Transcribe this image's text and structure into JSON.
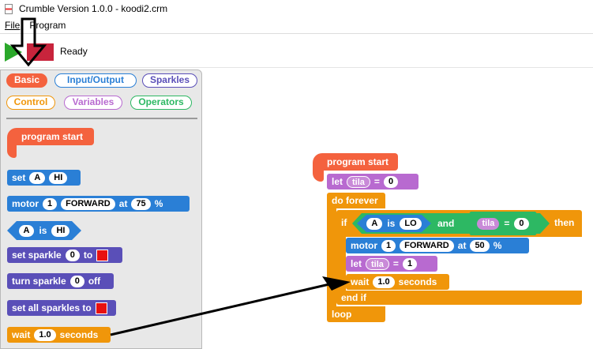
{
  "window": {
    "title": "Crumble Version 1.0.0 - koodi2.crm"
  },
  "menu": {
    "file": "File",
    "program": "Program"
  },
  "toolbar": {
    "status": "Ready"
  },
  "palette": {
    "categories": [
      "Basic",
      "Input/Output",
      "Sparkles",
      "Control",
      "Variables",
      "Operators"
    ],
    "blocks": {
      "program_start": "program start",
      "set_kw": "set",
      "set_pin": "A",
      "set_val": "HI",
      "motor_kw": "motor",
      "motor_num": "1",
      "motor_dir": "FORWARD",
      "motor_at": "at",
      "motor_pct": "75",
      "motor_unit": "%",
      "is_pin": "A",
      "is_kw": "is",
      "is_val": "HI",
      "set_sparkle_kw": "set sparkle",
      "set_sparkle_num": "0",
      "set_sparkle_to": "to",
      "turn_sparkle_kw": "turn sparkle",
      "turn_sparkle_num": "0",
      "turn_sparkle_off": "off",
      "set_all_kw": "set all sparkles to",
      "wait_kw": "wait",
      "wait_val": "1.0",
      "wait_unit": "seconds"
    }
  },
  "script": {
    "program_start": "program start",
    "let_kw": "let",
    "let_var": "tila",
    "let_eq": "=",
    "let_val": "0",
    "do_forever": "do forever",
    "if_kw": "if",
    "cond_pin": "A",
    "cond_is": "is",
    "cond_val": "LO",
    "and_kw": "and",
    "cond2_var": "tila",
    "cond2_eq": "=",
    "cond2_val": "0",
    "then_kw": "then",
    "motor_kw": "motor",
    "motor_num": "1",
    "motor_dir": "FORWARD",
    "motor_at": "at",
    "motor_pct": "50",
    "motor_unit": "%",
    "let2_kw": "let",
    "let2_var": "tila",
    "let2_eq": "=",
    "let2_val": "1",
    "wait_kw": "wait",
    "wait_val": "1.0",
    "wait_unit": "seconds",
    "end_if": "end if",
    "loop": "loop"
  },
  "colors": {
    "basic": "#f4623e",
    "io": "#2a7fd6",
    "sparkles": "#5a4fb8",
    "control": "#f0960a",
    "variables": "#b86ad0",
    "operators": "#2db863"
  }
}
